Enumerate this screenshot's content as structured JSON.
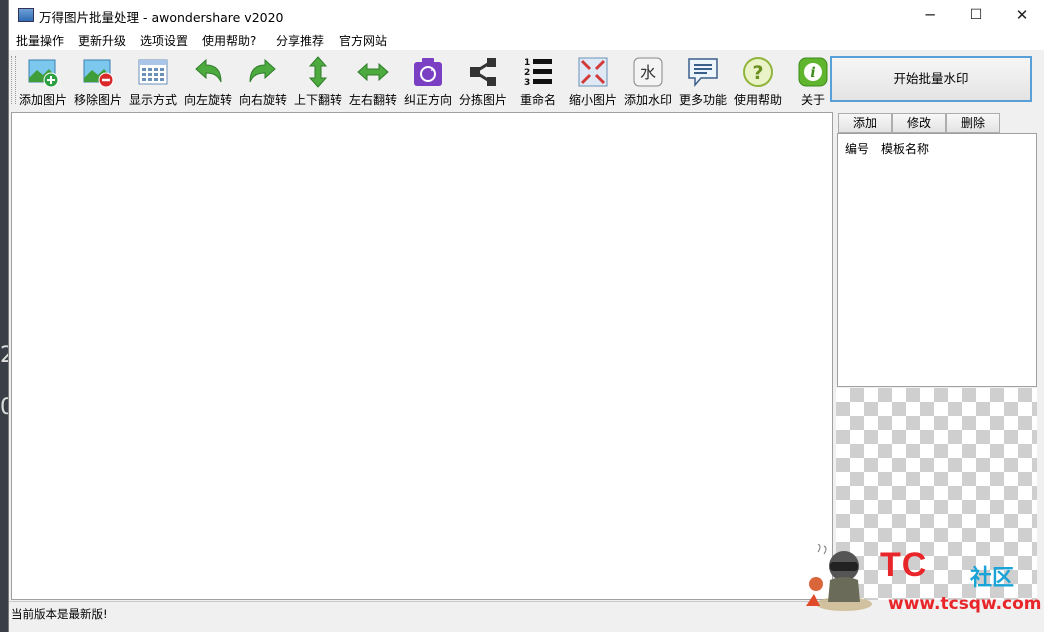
{
  "window": {
    "title": "万得图片批量处理 - awondershare v2020",
    "controls": {
      "minimize": "─",
      "maximize": "☐",
      "close": "✕"
    }
  },
  "menu": [
    "批量操作",
    "更新升级",
    "选项设置",
    "使用帮助?",
    "分享推荐",
    "官方网站"
  ],
  "toolbar": [
    {
      "label": "添加图片",
      "icon": "add-image-icon"
    },
    {
      "label": "移除图片",
      "icon": "remove-image-icon"
    },
    {
      "label": "显示方式",
      "icon": "display-mode-icon"
    },
    {
      "label": "向左旋转",
      "icon": "rotate-left-icon"
    },
    {
      "label": "向右旋转",
      "icon": "rotate-right-icon"
    },
    {
      "label": "上下翻转",
      "icon": "flip-vertical-icon"
    },
    {
      "label": "左右翻转",
      "icon": "flip-horizontal-icon"
    },
    {
      "label": "纠正方向",
      "icon": "correct-orientation-icon"
    },
    {
      "label": "分拣图片",
      "icon": "sort-images-icon"
    },
    {
      "label": "重命名",
      "icon": "rename-icon"
    },
    {
      "label": "缩小图片",
      "icon": "shrink-image-icon"
    },
    {
      "label": "添加水印",
      "icon": "add-watermark-icon"
    },
    {
      "label": "更多功能",
      "icon": "more-features-icon"
    },
    {
      "label": "使用帮助",
      "icon": "help-icon"
    },
    {
      "label": "关于",
      "icon": "about-icon"
    }
  ],
  "side_panel": {
    "start_button": "开始批量水印",
    "template_buttons": {
      "add": "添加",
      "edit": "修改",
      "delete": "删除"
    },
    "columns": [
      "编号",
      "模板名称"
    ]
  },
  "statusbar": {
    "text": "当前版本是最新版!"
  },
  "watermark_overlay": {
    "brand": "TC",
    "brand_suffix": "社区",
    "url": "www.tcsqw.com"
  },
  "background_glyphs": [
    "2",
    "0"
  ]
}
